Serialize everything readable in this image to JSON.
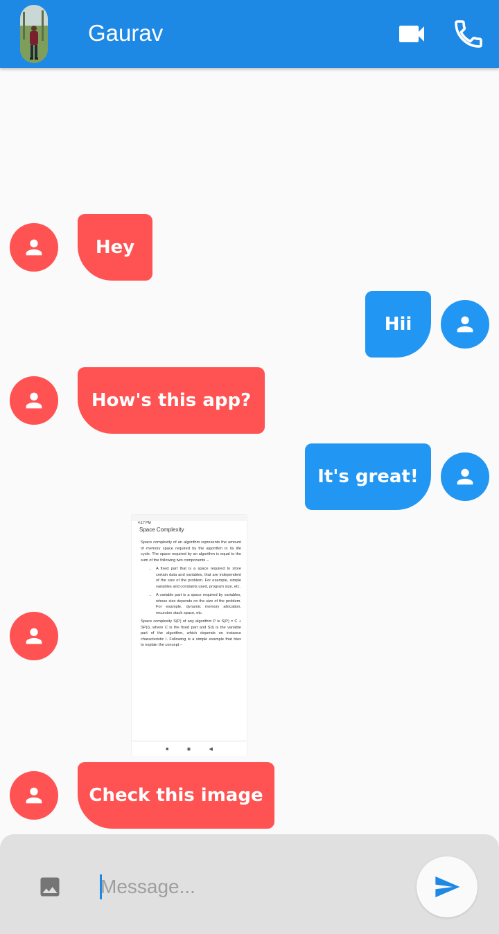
{
  "header": {
    "contact_name": "Gaurav",
    "video_icon": "videocam-icon",
    "call_icon": "phone-icon"
  },
  "messages": [
    {
      "from": "other",
      "text": "Hey"
    },
    {
      "from": "me",
      "text": "Hii"
    },
    {
      "from": "other",
      "text": "How's this app?"
    },
    {
      "from": "me",
      "text": "It's great!"
    },
    {
      "from": "other",
      "type": "image"
    },
    {
      "from": "other",
      "text": "Check this image"
    }
  ],
  "shared_image": {
    "status_time": "4:17 PM",
    "title": "Space Complexity",
    "para1": "Space complexity of an algorithm represents the amount of memory space required by the algorithm in its life cycle. The space required by an algorithm is equal to the sum of the following two components −",
    "bullet1": "A fixed part that is a space required to store certain data and variables, that are independent of the size of the problem. For example, simple variables and constants used, program size, etc.",
    "bullet2": "A variable part is a space required by variables, whose size depends on the size of the problem. For example, dynamic memory allocation, recursion stack space, etc.",
    "para2": "Space complexity S(P) of any algorithm P is S(P) = C + SP(I), where C is the fixed part and S(I) is the variable part of the algorithm, which depends on instance characteristic I. Following is a simple example that tries to explain the concept −",
    "nav_glyphs": [
      "■",
      "◉",
      "◀"
    ]
  },
  "composer": {
    "placeholder": "Message...",
    "image_icon": "image-icon",
    "send_icon": "send-icon"
  },
  "colors": {
    "app_bar": "#1e88e5",
    "received_bubble": "#ff5252",
    "sent_bubble": "#2196f3",
    "background": "#fafafa",
    "composer": "#e0e0e0"
  }
}
